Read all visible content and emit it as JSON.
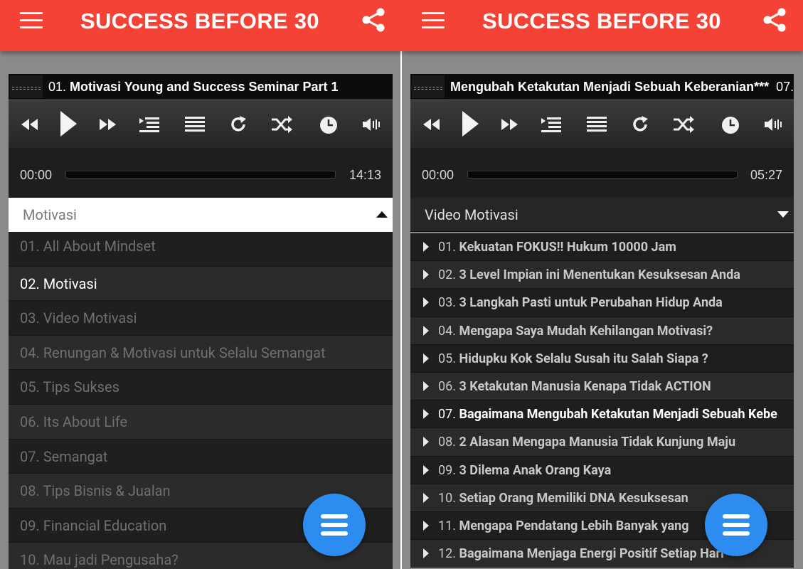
{
  "app": {
    "title": "SUCCESS BEFORE 30",
    "accent": "#f44336",
    "fab_color": "#2d8cf0"
  },
  "left": {
    "now_playing_num": "01.",
    "now_playing": "Motivasi Young and Success Seminar Part 1",
    "time_current": "00:00",
    "time_total": "14:13",
    "dropdown_label": "Motivasi",
    "categories": [
      "01. All About Mindset",
      "02. Motivasi",
      "03. Video Motivasi",
      "04. Renungan & Motivasi untuk Selalu Semangat",
      "05. Tips Sukses",
      "06. Its About Life",
      "07. Semangat",
      "08. Tips Bisnis & Jualan",
      "09. Financial Education",
      "10. Mau jadi Pengusaha?"
    ],
    "active_index": 1
  },
  "right": {
    "now_playing": "Mengubah Ketakutan Menjadi Sebuah Keberanian***",
    "now_playing_tail": "07.",
    "time_current": "00:00",
    "time_total": "05:27",
    "dropdown_label": "Video Motivasi",
    "videos": [
      {
        "n": "01.",
        "t": "Kekuatan FOKUS!! Hukum 10000 Jam"
      },
      {
        "n": "02.",
        "t": "3 Level Impian ini Menentukan Kesuksesan Anda"
      },
      {
        "n": "03.",
        "t": "3 Langkah Pasti untuk Perubahan Hidup Anda"
      },
      {
        "n": "04.",
        "t": "Mengapa Saya Mudah Kehilangan Motivasi?"
      },
      {
        "n": "05.",
        "t": "Hidupku Kok Selalu Susah itu Salah Siapa ?"
      },
      {
        "n": "06.",
        "t": "3 Ketakutan Manusia Kenapa Tidak ACTION"
      },
      {
        "n": "07.",
        "t": "Bagaimana Mengubah Ketakutan Menjadi Sebuah Kebe"
      },
      {
        "n": "08.",
        "t": "2 Alasan Mengapa Manusia Tidak Kunjung Maju"
      },
      {
        "n": "09.",
        "t": "3 Dilema Anak Orang Kaya"
      },
      {
        "n": "10.",
        "t": "Setiap Orang Memiliki DNA Kesuksesan"
      },
      {
        "n": "11.",
        "t": "Mengapa Pendatang Lebih Banyak yang"
      },
      {
        "n": "12.",
        "t": "Bagaimana Menjaga Energi Positif Setiap Hari"
      }
    ],
    "active_index": 6
  },
  "icons": {
    "menu": "hamburger-icon",
    "share": "share-icon",
    "rewind": "rewind-icon",
    "play": "play-icon",
    "forward": "fast-forward-icon",
    "queue": "queue-icon",
    "playlist": "playlist-icon",
    "repeat": "repeat-icon",
    "shuffle": "shuffle-icon",
    "timer": "timer-icon",
    "volume": "volume-icon",
    "fab": "menu-fab-icon"
  }
}
